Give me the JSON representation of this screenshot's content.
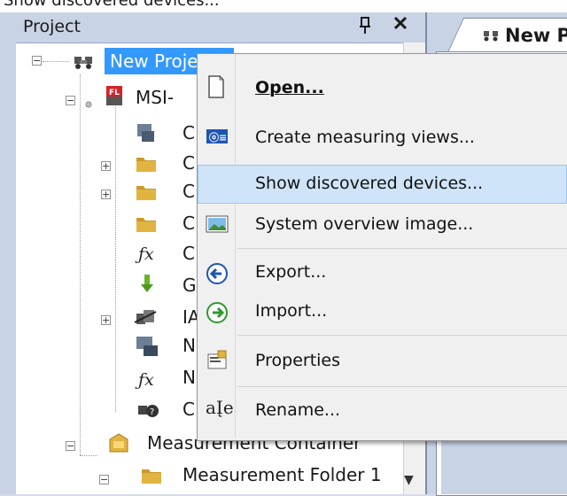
{
  "window": {
    "top_caption": "Show discovered devices...",
    "panel_title": "Project",
    "pin_glyph": "ᵖ",
    "close_glyph": "×",
    "document_tab_label": "New P"
  },
  "tree": {
    "root_label": "New Project",
    "device_label": "MSI-",
    "child_labels": [
      "C",
      "C",
      "C",
      "C",
      "C",
      "G",
      "IA",
      "N",
      "N",
      "C"
    ],
    "container_label": "Measurement Container",
    "folder_label": "Measurement Folder 1"
  },
  "context_menu": {
    "items": [
      {
        "label": "Open...",
        "icon": "open-document-icon",
        "bold": true,
        "highlighted": false
      },
      {
        "label": "Create measuring views...",
        "icon": "measuring-view-icon",
        "bold": false,
        "highlighted": false
      },
      {
        "label": "Show discovered devices...",
        "icon": "",
        "bold": false,
        "highlighted": true
      },
      {
        "label": "System overview image...",
        "icon": "image-icon",
        "bold": false,
        "highlighted": false
      },
      {
        "label": "Export...",
        "icon": "export-arrow-icon",
        "bold": false,
        "highlighted": false
      },
      {
        "label": "Import...",
        "icon": "import-arrow-icon",
        "bold": false,
        "highlighted": false
      },
      {
        "label": "Properties",
        "icon": "properties-icon",
        "bold": false,
        "highlighted": false
      },
      {
        "label": "Rename...",
        "icon": "rename-icon",
        "bold": false,
        "highlighted": false
      }
    ]
  },
  "colors": {
    "selection": "#3399ff",
    "menu_highlight": "#cfe4f8",
    "panel_header": "#c9d3e6"
  }
}
